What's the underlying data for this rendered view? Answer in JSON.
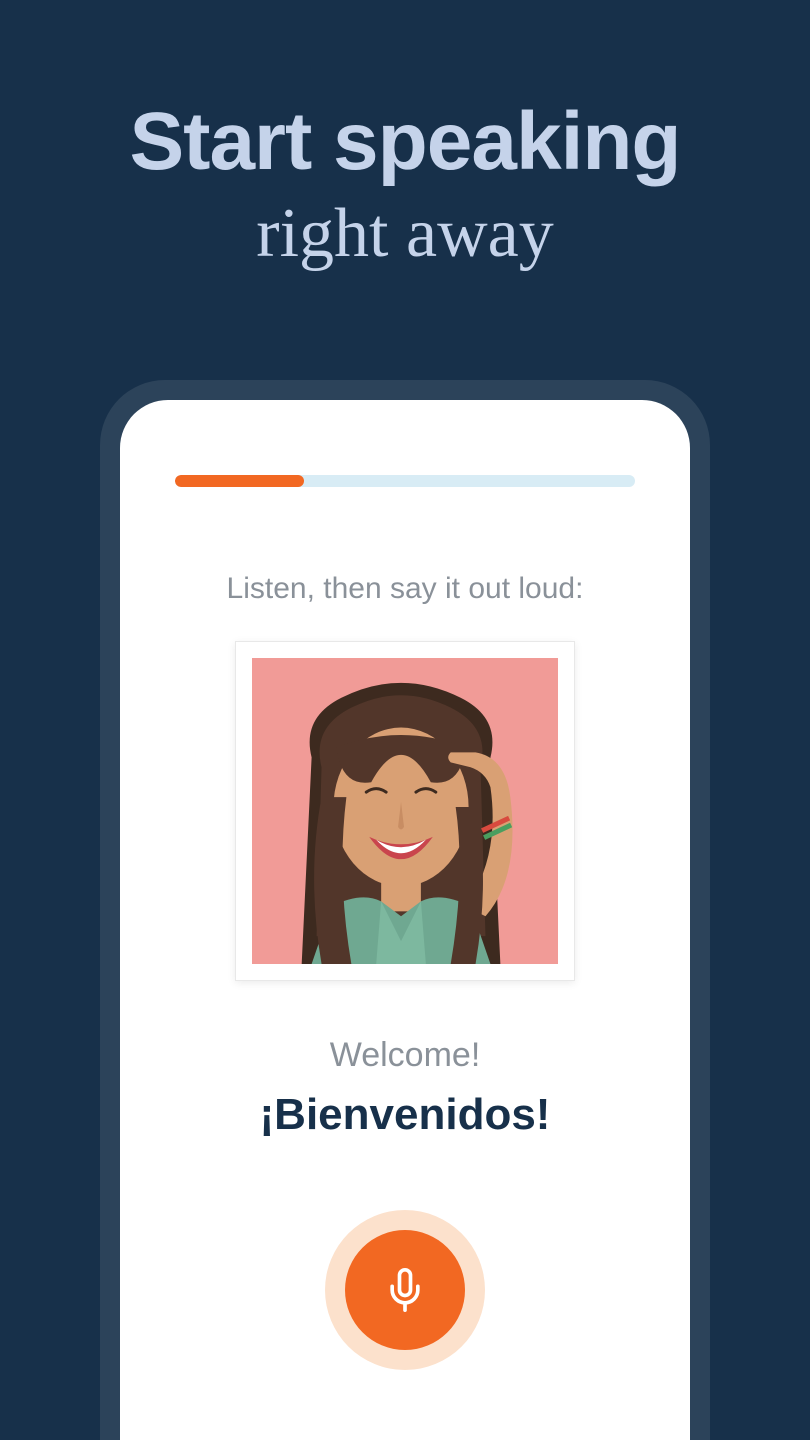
{
  "heading": {
    "line1": "Start speaking",
    "line2": "right away"
  },
  "lesson": {
    "instruction": "Listen, then say it out loud:",
    "translation": "Welcome!",
    "target_phrase": "¡Bienvenidos!",
    "progress_percent": 28
  },
  "colors": {
    "background": "#17304a",
    "accent": "#f26822",
    "heading_text": "#c5d3ea",
    "muted_text": "#8a9199"
  }
}
